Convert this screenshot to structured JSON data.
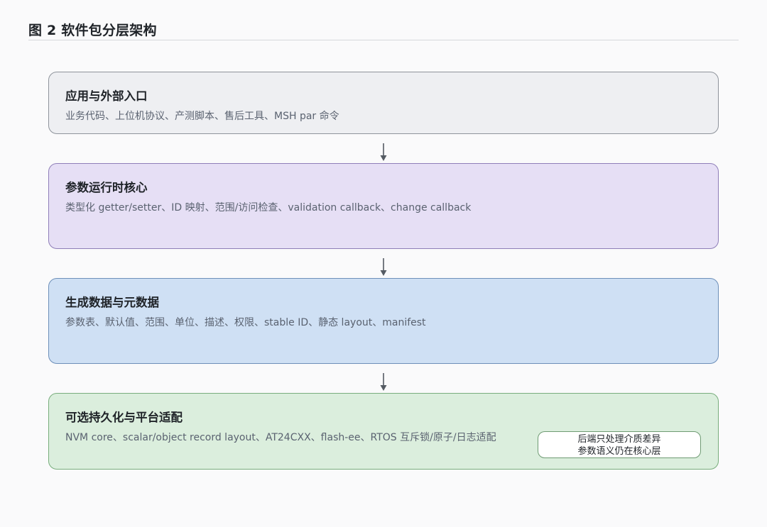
{
  "figure": {
    "title": "图 2  软件包分层架构"
  },
  "layers": [
    {
      "title": "应用与外部入口",
      "description": "业务代码、上位机协议、产测脚本、售后工具、MSH par 命令"
    },
    {
      "title": "参数运行时核心",
      "description": "类型化 getter/setter、ID 映射、范围/访问检查、validation callback、change callback"
    },
    {
      "title": "生成数据与元数据",
      "description": "参数表、默认值、范围、单位、描述、权限、stable ID、静态 layout、manifest"
    },
    {
      "title": "可选持久化与平台适配",
      "description": "NVM core、scalar/object record layout、AT24CXX、flash-ee、RTOS 互斥锁/原子/日志适配"
    }
  ],
  "note": {
    "line1": "后端只处理介质差异",
    "line2": "参数语义仍在核心层"
  },
  "colors": {
    "layer1_fill": "#eeeff2",
    "layer2_fill": "#e6dff5",
    "layer3_fill": "#cfe0f4",
    "layer4_fill": "#dbeedd",
    "arrow": "#555b63"
  },
  "icons": {
    "connector": "down-arrow-icon"
  }
}
